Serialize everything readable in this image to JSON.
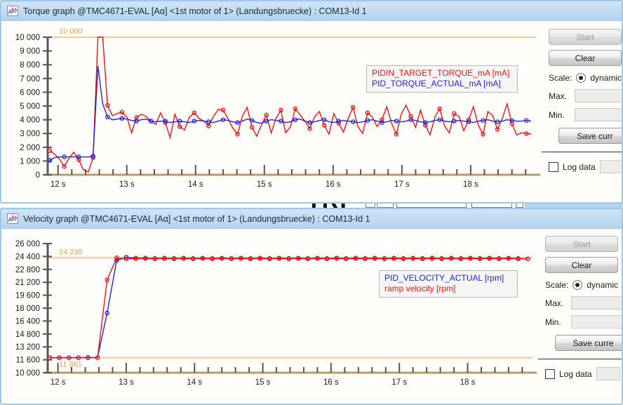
{
  "background_window": {
    "logo_text": "TRI"
  },
  "panels": [
    {
      "id": "torque",
      "title": "Torque graph @TMC4671-EVAL [Aα] <1st motor of 1> (Landungsbruecke) : COM13-Id 1",
      "icon": "chart-icon",
      "legend": [
        {
          "label": "PIDIN_TARGET_TORQUE_mA [mA]",
          "color": "#ee1111"
        },
        {
          "label": "PID_TORQUE_ACTUAL_mA [mA]",
          "color": "#2222dd"
        }
      ],
      "controls": {
        "start_label": "Start",
        "clear_label": "Clear",
        "scale_label": "Scale:",
        "scale_value": "dynamic",
        "max_label": "Max.",
        "max_value": "",
        "min_label": "Min.",
        "min_value": "",
        "save_label": "Save curr",
        "log_label": "Log data",
        "log_value": ""
      },
      "chart_data": {
        "type": "line",
        "title": "Torque graph",
        "xlabel": "",
        "ylabel": "",
        "grid": false,
        "legend_position": "inside-top-right",
        "xlim": [
          11.85,
          18.95
        ],
        "ylim": [
          0,
          10000
        ],
        "xticks": [
          "12 s",
          "13 s",
          "14 s",
          "15 s",
          "16 s",
          "17 s",
          "18 s"
        ],
        "xtick_values": [
          12,
          13,
          14,
          15,
          16,
          17,
          18
        ],
        "yticks": [
          "0",
          "1 000",
          "2 000",
          "3 000",
          "4 000",
          "5 000",
          "6 000",
          "7 000",
          "8 000",
          "9 000",
          "10 000"
        ],
        "ytick_values": [
          0,
          1000,
          2000,
          3000,
          4000,
          5000,
          6000,
          7000,
          8000,
          9000,
          10000
        ],
        "reference_lines": [
          {
            "value": 10000,
            "label": "10 000",
            "color": "#f5c89a"
          },
          {
            "value": 0,
            "label": "",
            "color": "#c9a06a"
          }
        ],
        "series": [
          {
            "name": "PIDIN_TARGET_TORQUE_mA [mA]",
            "color": "#ee1111",
            "x": [
              11.88,
              11.95,
              12.02,
              12.09,
              12.16,
              12.23,
              12.3,
              12.37,
              12.44,
              12.51,
              12.58,
              12.65,
              12.72,
              12.79,
              12.86,
              12.93,
              13.0,
              13.07,
              13.14,
              13.21,
              13.28,
              13.35,
              13.42,
              13.49,
              13.56,
              13.63,
              13.7,
              13.77,
              13.84,
              13.91,
              13.98,
              14.05,
              14.12,
              14.19,
              14.26,
              14.33,
              14.4,
              14.47,
              14.54,
              14.61,
              14.68,
              14.75,
              14.82,
              14.89,
              14.96,
              15.03,
              15.1,
              15.17,
              15.24,
              15.31,
              15.38,
              15.45,
              15.52,
              15.59,
              15.66,
              15.73,
              15.8,
              15.87,
              15.94,
              16.01,
              16.08,
              16.15,
              16.22,
              16.29,
              16.36,
              16.43,
              16.5,
              16.57,
              16.64,
              16.71,
              16.78,
              16.85,
              16.92,
              16.99,
              17.06,
              17.13,
              17.2,
              17.27,
              17.34,
              17.41,
              17.48,
              17.55,
              17.62,
              17.69,
              17.76,
              17.83,
              17.9,
              17.97,
              18.04,
              18.11,
              18.18,
              18.25,
              18.32,
              18.39,
              18.46,
              18.53,
              18.6,
              18.67,
              18.74,
              18.81,
              18.88
            ],
            "values": [
              1750,
              1500,
              1150,
              600,
              1200,
              1650,
              1100,
              350,
              200,
              1250,
              10000,
              10000,
              5050,
              4300,
              4450,
              4550,
              4200,
              3050,
              4150,
              4400,
              4250,
              3900,
              3650,
              4500,
              3800,
              2700,
              4400,
              3500,
              3250,
              4200,
              4500,
              4100,
              3900,
              3550,
              4250,
              4750,
              4700,
              4100,
              3400,
              2950,
              4250,
              4900,
              3450,
              2800,
              3650,
              4350,
              3050,
              4100,
              4700,
              3050,
              3500,
              4800,
              4350,
              3900,
              3350,
              4200,
              4600,
              3600,
              2950,
              4450,
              3750,
              3100,
              4100,
              4900,
              3500,
              3000,
              4500,
              4200,
              3500,
              4000,
              4950,
              3750,
              2950,
              4400,
              5050,
              4250,
              3450,
              4700,
              3600,
              2900,
              4200,
              4800,
              3550,
              3050,
              4450,
              4250,
              3200,
              4000,
              4950,
              3600,
              2950,
              4600,
              4300,
              3300,
              4100,
              5150,
              3700,
              2900,
              3050,
              3000,
              2950
            ]
          },
          {
            "name": "PID_TORQUE_ACTUAL_mA [mA]",
            "color": "#2222dd",
            "x": [
              11.88,
              11.95,
              12.02,
              12.09,
              12.16,
              12.23,
              12.3,
              12.37,
              12.44,
              12.51,
              12.58,
              12.65,
              12.72,
              12.79,
              12.86,
              12.93,
              13.0,
              13.07,
              13.14,
              13.21,
              13.28,
              13.35,
              13.42,
              13.49,
              13.56,
              13.63,
              13.7,
              13.77,
              13.84,
              13.91,
              13.98,
              14.05,
              14.12,
              14.19,
              14.26,
              14.33,
              14.4,
              14.47,
              14.54,
              14.61,
              14.68,
              14.75,
              14.82,
              14.89,
              14.96,
              15.03,
              15.1,
              15.17,
              15.24,
              15.31,
              15.38,
              15.45,
              15.52,
              15.59,
              15.66,
              15.73,
              15.8,
              15.87,
              15.94,
              16.01,
              16.08,
              16.15,
              16.22,
              16.29,
              16.36,
              16.43,
              16.5,
              16.57,
              16.64,
              16.71,
              16.78,
              16.85,
              16.92,
              16.99,
              17.06,
              17.13,
              17.2,
              17.27,
              17.34,
              17.41,
              17.48,
              17.55,
              17.62,
              17.69,
              17.76,
              17.83,
              17.9,
              17.97,
              18.04,
              18.11,
              18.18,
              18.25,
              18.32,
              18.39,
              18.46,
              18.53,
              18.6,
              18.67,
              18.74,
              18.81,
              18.88
            ],
            "values": [
              1050,
              1250,
              1300,
              1300,
              1300,
              1300,
              1300,
              1300,
              1300,
              1350,
              7900,
              5150,
              4200,
              4000,
              4050,
              4100,
              4050,
              3950,
              3900,
              4000,
              4050,
              3900,
              3850,
              3900,
              3900,
              3800,
              3850,
              3900,
              3850,
              3800,
              3900,
              3950,
              3900,
              3850,
              3800,
              3900,
              4000,
              3950,
              3850,
              3800,
              3900,
              4050,
              3950,
              3800,
              3750,
              3900,
              4000,
              3950,
              3900,
              3800,
              3850,
              4000,
              4050,
              3900,
              3800,
              3850,
              3950,
              4000,
              3850,
              3800,
              3900,
              3950,
              3900,
              3850,
              3800,
              3850,
              3950,
              4000,
              3900,
              3800,
              3850,
              3950,
              3900,
              3850,
              3900,
              4000,
              3950,
              3850,
              3800,
              3850,
              3950,
              4000,
              3900,
              3850,
              3900,
              3950,
              3900,
              3850,
              3800,
              3900,
              3950,
              4000,
              3900,
              3850,
              3900,
              4000,
              3950,
              3900,
              3900,
              3950,
              3900
            ]
          }
        ]
      }
    },
    {
      "id": "velocity",
      "title": "Velocity graph @TMC4671-EVAL [Aα] <1st motor of 1> (Landungsbruecke) : COM13-Id 1",
      "icon": "chart-icon",
      "legend": [
        {
          "label": "PID_VELOCITY_ACTUAL [rpm]",
          "color": "#2222dd"
        },
        {
          "label": "ramp velocity [rpm]",
          "color": "#ee1111"
        }
      ],
      "controls": {
        "start_label": "Start",
        "clear_label": "Clear",
        "scale_label": "Scale:",
        "scale_value": "dynamic",
        "max_label": "Max.",
        "max_value": "",
        "min_label": "Min.",
        "min_value": "",
        "save_label": "Save curre",
        "log_label": "Log data",
        "log_value": ""
      },
      "chart_data": {
        "type": "line",
        "title": "Velocity graph",
        "xlabel": "",
        "ylabel": "",
        "grid": false,
        "legend_position": "inside-top-right",
        "xlim": [
          11.85,
          18.95
        ],
        "ylim": [
          10000,
          26000
        ],
        "xticks": [
          "12 s",
          "13 s",
          "14 s",
          "15 s",
          "16 s",
          "17 s",
          "18 s"
        ],
        "xtick_values": [
          12,
          13,
          14,
          15,
          16,
          17,
          18
        ],
        "yticks": [
          "10 000",
          "11 600",
          "13 200",
          "14 800",
          "16 400",
          "18 000",
          "19 600",
          "21 200",
          "22 800",
          "24 400",
          "26 000"
        ],
        "ytick_values": [
          10000,
          11600,
          13200,
          14800,
          16400,
          18000,
          19600,
          21200,
          22800,
          24400,
          26000
        ],
        "reference_lines": [
          {
            "value": 24235,
            "label": "24 235",
            "color": "#f5c89a"
          },
          {
            "value": 11861,
            "label": "11 861",
            "color": "#f5c89a"
          }
        ],
        "series": [
          {
            "name": "PID_VELOCITY_ACTUAL [rpm]",
            "color": "#2222dd",
            "x": [
              11.88,
              12.02,
              12.16,
              12.3,
              12.44,
              12.58,
              12.72,
              12.86,
              13.0,
              13.14,
              13.28,
              13.42,
              13.56,
              13.7,
              13.84,
              13.98,
              14.12,
              14.26,
              14.4,
              14.54,
              14.68,
              14.82,
              14.96,
              15.1,
              15.24,
              15.38,
              15.52,
              15.66,
              15.8,
              15.94,
              16.08,
              16.22,
              16.36,
              16.5,
              16.64,
              16.78,
              16.92,
              17.06,
              17.2,
              17.34,
              17.48,
              17.62,
              17.76,
              17.9,
              18.04,
              18.18,
              18.32,
              18.46,
              18.6,
              18.74,
              18.88
            ],
            "values": [
              11861,
              11861,
              11861,
              11861,
              11900,
              11861,
              17400,
              23900,
              24300,
              24200,
              24200,
              24150,
              24200,
              24150,
              24200,
              24150,
              24200,
              24150,
              24200,
              24150,
              24200,
              24150,
              24200,
              24150,
              24200,
              24150,
              24200,
              24150,
              24200,
              24150,
              24200,
              24150,
              24200,
              24150,
              24200,
              24150,
              24200,
              24150,
              24200,
              24150,
              24200,
              24150,
              24200,
              24150,
              24200,
              24150,
              24200,
              24150,
              24200,
              24150,
              24100
            ]
          },
          {
            "name": "ramp velocity [rpm]",
            "color": "#ee1111",
            "x": [
              11.88,
              12.02,
              12.16,
              12.3,
              12.44,
              12.58,
              12.72,
              12.86,
              13.0,
              13.14,
              13.28,
              13.42,
              13.56,
              13.7,
              13.84,
              13.98,
              14.12,
              14.26,
              14.4,
              14.54,
              14.68,
              14.82,
              14.96,
              15.1,
              15.24,
              15.38,
              15.52,
              15.66,
              15.8,
              15.94,
              16.08,
              16.22,
              16.36,
              16.5,
              16.64,
              16.78,
              16.92,
              17.06,
              17.2,
              17.34,
              17.48,
              17.62,
              17.76,
              17.9,
              18.04,
              18.18,
              18.32,
              18.46,
              18.6,
              18.74,
              18.88
            ],
            "values": [
              11861,
              11861,
              11861,
              11861,
              11861,
              11861,
              21500,
              24235,
              24100,
              24150,
              24150,
              24100,
              24150,
              24100,
              24150,
              24100,
              24150,
              24100,
              24150,
              24100,
              24150,
              24100,
              24150,
              24100,
              24150,
              24100,
              24150,
              24100,
              24150,
              24100,
              24150,
              24100,
              24150,
              24100,
              24150,
              24100,
              24150,
              24100,
              24150,
              24100,
              24150,
              24100,
              24150,
              24100,
              24150,
              24100,
              24150,
              24100,
              24150,
              24100,
              24100
            ]
          }
        ]
      }
    }
  ]
}
